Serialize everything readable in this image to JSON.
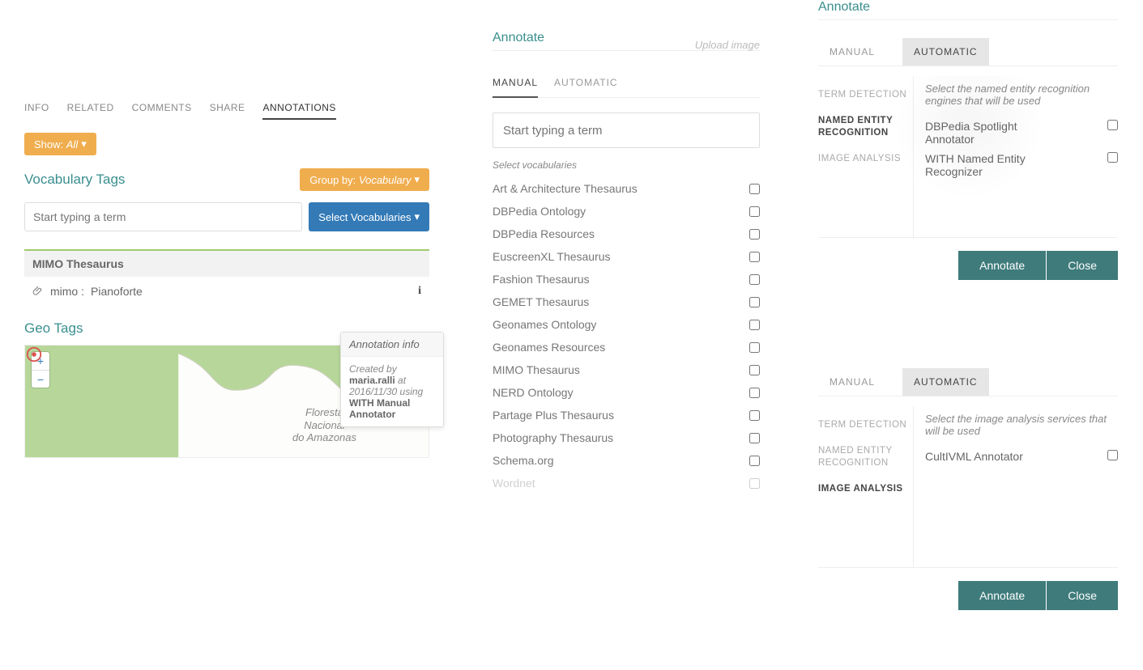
{
  "left": {
    "tabs": [
      "INFO",
      "RELATED",
      "COMMENTS",
      "SHARE",
      "ANNOTATIONS"
    ],
    "active_tab_index": 4,
    "show_label": "Show:",
    "show_value": "All",
    "vocab_tags_title": "Vocabulary Tags",
    "group_by_label": "Group by:",
    "group_by_value": "Vocabulary",
    "term_placeholder": "Start typing a term",
    "select_vocab_btn": "Select Vocabularies",
    "mimo_header": "MIMO Thesaurus",
    "mimo_item_prefix": "mimo :",
    "mimo_item_value": "Pianoforte",
    "geo_title": "Geo Tags",
    "map_label_text": "Floresta\nNacional\ndo Amazonas",
    "zoom_in": "+",
    "zoom_out": "−",
    "popover": {
      "title": "Annotation info",
      "created_by_label": "Created by",
      "user": "maria.ralli",
      "at_label": "at",
      "date": "2016/11/30",
      "using_label": "using",
      "tool": "WITH Manual Annotator"
    }
  },
  "mid": {
    "heading": "Annotate",
    "upload_ghost": "Upload image",
    "tabs": [
      "MANUAL",
      "AUTOMATIC"
    ],
    "active_tab_index": 0,
    "term_placeholder": "Start typing a term",
    "select_label": "Select vocabularies",
    "vocabularies": [
      "Art & Architecture Thesaurus",
      "DBPedia Ontology",
      "DBPedia Resources",
      "EuscreenXL Thesaurus",
      "Fashion Thesaurus",
      "GEMET Thesaurus",
      "Geonames Ontology",
      "Geonames Resources",
      "MIMO Thesaurus",
      "NERD Ontology",
      "Partage Plus Thesaurus",
      "Photography Thesaurus",
      "Schema.org",
      "Wordnet"
    ]
  },
  "right1": {
    "heading": "Annotate",
    "tabs": [
      "MANUAL",
      "AUTOMATIC"
    ],
    "active_tab_index": 1,
    "nav": [
      "TERM DETECTION",
      "NAMED ENTITY RECOGNITION",
      "IMAGE ANALYSIS"
    ],
    "active_nav_index": 1,
    "instruction": "Select the named entity recognition engines that will be used",
    "engines": [
      "DBPedia Spotlight Annotator",
      "WITH Named Entity Recognizer"
    ],
    "annotate_btn": "Annotate",
    "close_btn": "Close"
  },
  "right2": {
    "tabs": [
      "MANUAL",
      "AUTOMATIC"
    ],
    "active_tab_index": 1,
    "nav": [
      "TERM DETECTION",
      "NAMED ENTITY RECOGNITION",
      "IMAGE ANALYSIS"
    ],
    "active_nav_index": 2,
    "instruction": "Select the image analysis services that will be used",
    "engines": [
      "CultIVML Annotator"
    ],
    "annotate_btn": "Annotate",
    "close_btn": "Close"
  }
}
